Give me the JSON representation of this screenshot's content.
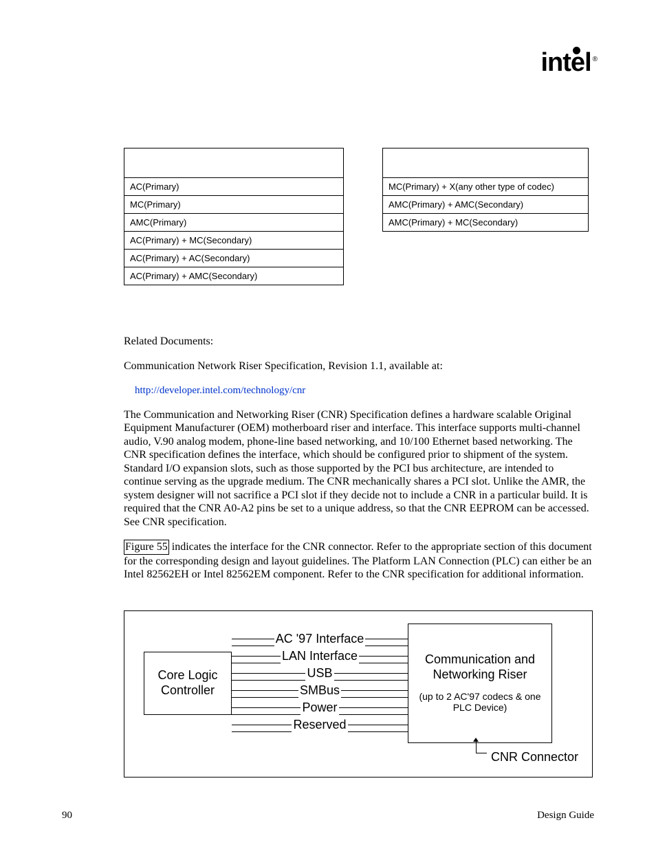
{
  "logo": {
    "brand": "intel",
    "reg": "®"
  },
  "left_table": [
    "AC(Primary)",
    "MC(Primary)",
    "AMC(Primary)",
    "AC(Primary) + MC(Secondary)",
    "AC(Primary) + AC(Secondary)",
    "AC(Primary) + AMC(Secondary)"
  ],
  "right_table": [
    "MC(Primary) + X(any other type of codec)",
    "AMC(Primary) + AMC(Secondary)",
    "AMC(Primary) + MC(Secondary)"
  ],
  "related": {
    "heading": "Related Documents:",
    "line": "Communication Network Riser Specification, Revision 1.1, available at:",
    "url": "http://developer.intel.com/technology/cnr"
  },
  "para1": "The Communication and Networking Riser (CNR) Specification defines a hardware scalable Original Equipment Manufacturer (OEM) motherboard riser and interface.  This interface supports multi-channel audio, V.90 analog modem, phone-line based networking, and 10/100 Ethernet based networking.  The CNR specification defines the interface, which should be configured prior to shipment of the system.  Standard I/O expansion slots, such as those supported by the PCI bus architecture, are intended to continue serving as the upgrade medium.  The CNR mechanically shares a PCI slot.  Unlike the AMR, the system designer will not sacrifice a PCI slot if they decide not to include a CNR in a particular build.  It is required that the CNR A0-A2 pins be set to a unique address, so that the CNR EEPROM can be accessed.  See CNR specification.",
  "para2_ref": "Figure 55",
  "para2_rest": " indicates the interface for the CNR connector.  Refer to the appropriate section of this document for the corresponding design and layout guidelines.  The Platform LAN Connection (PLC) can either be an Intel 82562EH or Intel 82562EM component.  Refer to the CNR specification for additional information.",
  "figure": {
    "core": "Core Logic Controller",
    "ports": [
      "AC '97 Interface",
      "LAN Interface",
      "USB",
      "SMBus",
      "Power",
      "Reserved"
    ],
    "cnr_title": "Communication and Networking Riser",
    "cnr_sub": "(up to 2 AC'97 codecs & one PLC Device)",
    "connector": "CNR Connector"
  },
  "footer": {
    "page_num": "90",
    "label": "Design Guide"
  }
}
